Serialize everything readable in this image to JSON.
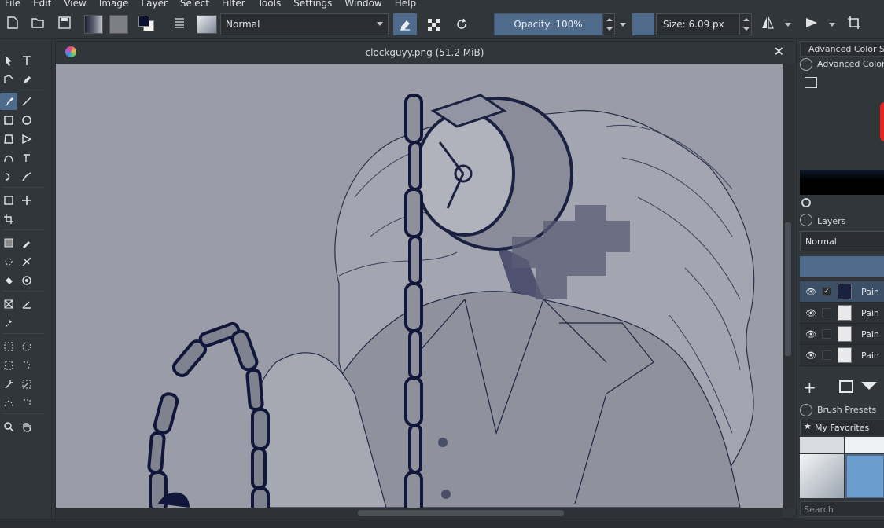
{
  "menubar": {
    "items": [
      "File",
      "Edit",
      "View",
      "Image",
      "Layer",
      "Select",
      "Filter",
      "Tools",
      "Settings",
      "Window",
      "Help"
    ]
  },
  "toolbar": {
    "blend_mode": "Normal",
    "opacity_label": "Opacity: 100%",
    "size_label": "Size: 6.09 px"
  },
  "document": {
    "title": "clockguyy.png (51.2 MiB)"
  },
  "docker": {
    "color_selector_tab": "Advanced Color Sel",
    "color_selector_title": "Advanced Color S",
    "layers_title": "Layers",
    "layers_blend": "Normal",
    "layers": [
      {
        "name": "Pain",
        "checked": true
      },
      {
        "name": "Pain",
        "checked": false
      },
      {
        "name": "Pain",
        "checked": false
      },
      {
        "name": "Pain",
        "checked": false
      }
    ],
    "brush_presets_title": "Brush Presets",
    "favorites_label": "My Favorites",
    "search_placeholder": "Search"
  },
  "colors": {
    "accent": "#4e6b8c",
    "canvas_bg": "#9a9ca7",
    "ink": "#1b2140",
    "panel_bg": "#31363b"
  }
}
